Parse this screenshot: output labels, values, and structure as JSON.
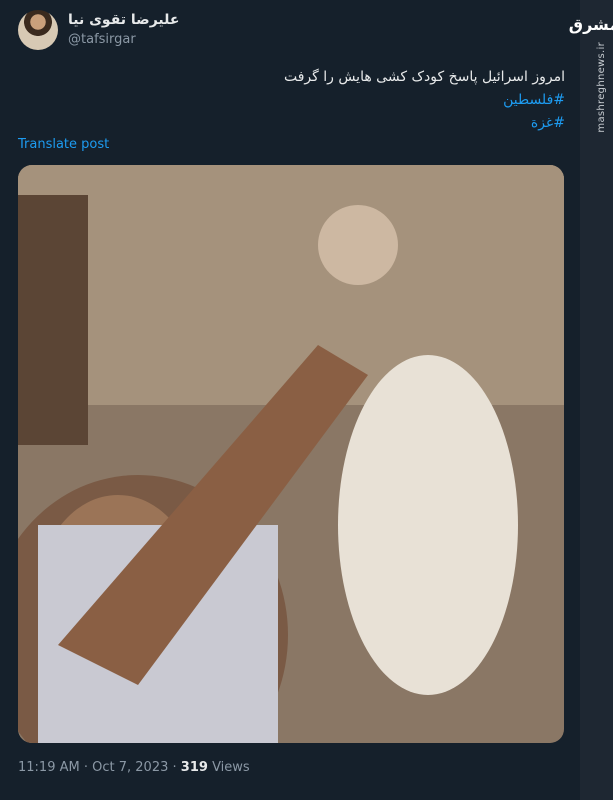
{
  "author": {
    "name": "علیرضا تقوی نیا",
    "handle": "@tafsirgar"
  },
  "tweet": {
    "text": "امروز اسرائیل پاسخ کودک کشی هایش را گرفت",
    "hashtags": [
      "#فلسطین",
      "#غزة"
    ],
    "translate_label": "Translate post"
  },
  "meta": {
    "time": "11:19 AM",
    "separator": "·",
    "date": "Oct 7, 2023",
    "separator2": "·",
    "views_count": "319",
    "views_label": "Views"
  },
  "watermark": {
    "logo_text": "مشرق",
    "site": "mashreghnews.ir"
  },
  "photo": {
    "icon": "photo-image"
  }
}
